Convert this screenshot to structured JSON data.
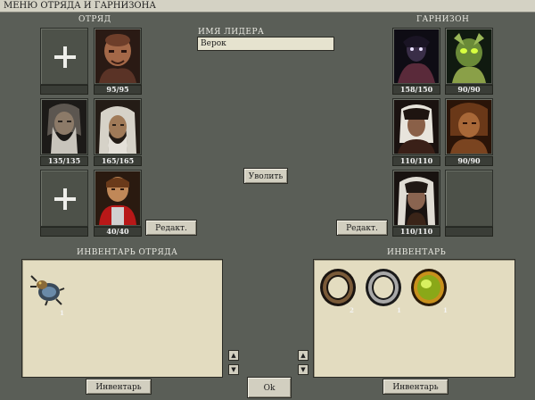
{
  "window": {
    "title": "МЕНЮ ОТРЯДА И ГАРНИЗОНА"
  },
  "squad": {
    "label": "ОТРЯД",
    "units": [
      {
        "hp": "95/95"
      },
      {
        "hp": "135/135"
      },
      {
        "hp": "165/165"
      },
      {
        "hp": "40/40"
      }
    ],
    "edit_button": "Редакт."
  },
  "leader": {
    "label": "ИМЯ ЛИДЕРА",
    "name": "Верок"
  },
  "dismiss_button": "Уволить",
  "garrison": {
    "label": "ГАРНИЗОН",
    "units": [
      {
        "hp": "158/150"
      },
      {
        "hp": "90/90"
      },
      {
        "hp": "110/110"
      },
      {
        "hp": "90/90"
      },
      {
        "hp": "110/110"
      }
    ],
    "edit_button": "Редакт."
  },
  "squad_inventory": {
    "label": "ИНВЕНТАРЬ ОТРЯДА",
    "items": [
      {
        "icon": "scarab-beetle-icon",
        "qty": "1"
      }
    ],
    "button": "Инвентарь"
  },
  "inventory": {
    "label": "ИНВЕНТАРЬ",
    "items": [
      {
        "icon": "bronze-ring-icon",
        "qty": "2"
      },
      {
        "icon": "silver-ring-icon",
        "qty": "1"
      },
      {
        "icon": "gem-ring-icon",
        "qty": "1"
      }
    ],
    "button": "Инвентарь"
  },
  "ok_button": "Ok",
  "scroll_up_glyph": "▲",
  "scroll_down_glyph": "▼",
  "colors": {
    "panel": "#5a5e57",
    "parchment": "#e3dcc0",
    "button": "#d2cfc0"
  }
}
